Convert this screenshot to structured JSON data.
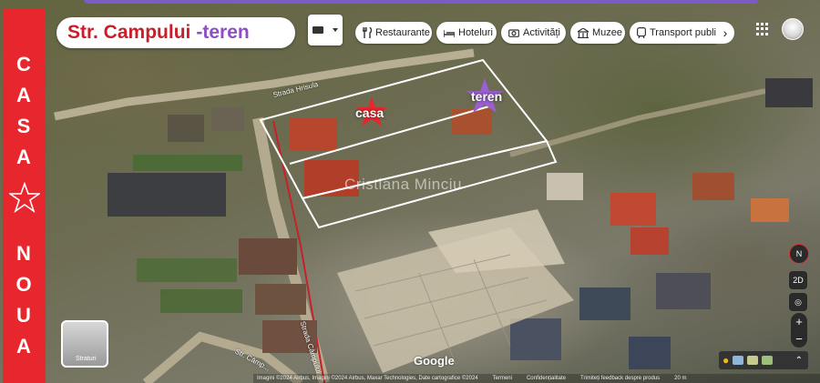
{
  "banner": {
    "letters_top": [
      "C",
      "A",
      "S",
      "A"
    ],
    "letters_bottom": [
      "N",
      "O",
      "U",
      "A"
    ],
    "icon": "star-outline-icon",
    "color": "#e8262d"
  },
  "title": {
    "main": "Str. Campului",
    "accent": "-teren",
    "main_color": "#c8202a",
    "accent_color": "#8e4fc4"
  },
  "categories": [
    {
      "label": "Restaurante",
      "icon": "utensils-icon"
    },
    {
      "label": "Hoteluri",
      "icon": "bed-icon"
    },
    {
      "label": "Activități",
      "icon": "camera-icon"
    },
    {
      "label": "Muzee",
      "icon": "museum-icon"
    },
    {
      "label": "Transport publi",
      "icon": "transit-icon"
    }
  ],
  "map_labels": {
    "casa": "casa",
    "teren": "teren",
    "watermark": "Cristiana Minciu",
    "street_top": "Strada Hrisula",
    "street_side": "Strada Câmpului",
    "street_bottom": "Str. Câmp..."
  },
  "google": "Google",
  "attribution": [
    "Imagini ©2024 Airbus, Imagini ©2024 Airbus, Maxar Technologies, Date cartografice ©2024",
    "Termeni",
    "Confidențialitate",
    "Trimiteți feedback despre produs",
    "20 m"
  ],
  "streetview_label": "Straturi",
  "controls": {
    "compass": "N",
    "tilt": "2D",
    "zoom_in": "+",
    "zoom_out": "−"
  },
  "colors": {
    "boundary": "#ffffff",
    "road_red": "#c8202a",
    "star_red": "#e8262d",
    "star_purple": "#9a5fd0"
  }
}
